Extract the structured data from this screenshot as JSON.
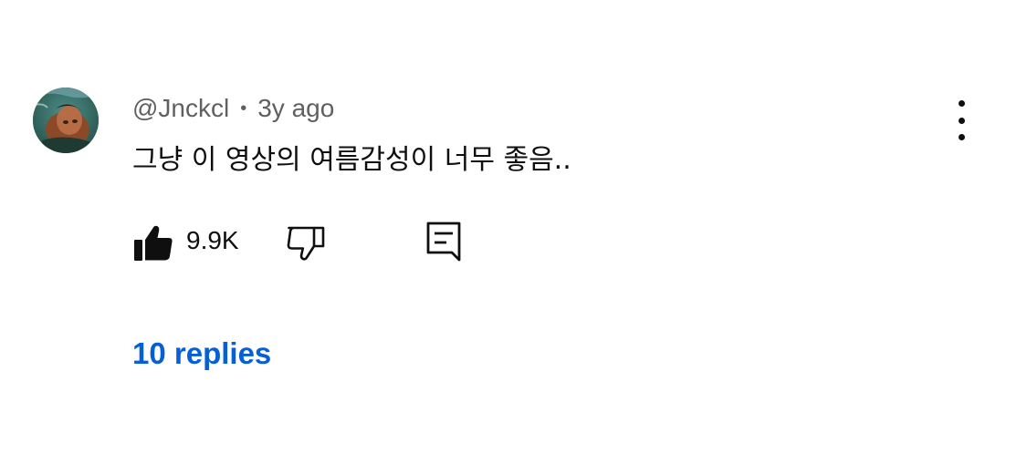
{
  "comment": {
    "author": "@Jnckcl",
    "separator": "•",
    "time": "3y ago",
    "text": "그냥 이 영상의 여름감성이 너무 좋음..",
    "like_count": "9.9K",
    "replies_label": "10 replies",
    "avatar_icon": "user-avatar-photo"
  },
  "icons": {
    "like": "thumbs-up-filled-icon",
    "dislike": "thumbs-down-outline-icon",
    "reply": "comment-reply-icon",
    "more": "more-vertical-icon"
  },
  "colors": {
    "text_primary": "#0f0f0f",
    "text_secondary": "#606060",
    "link": "#065fd4",
    "background": "#ffffff"
  }
}
